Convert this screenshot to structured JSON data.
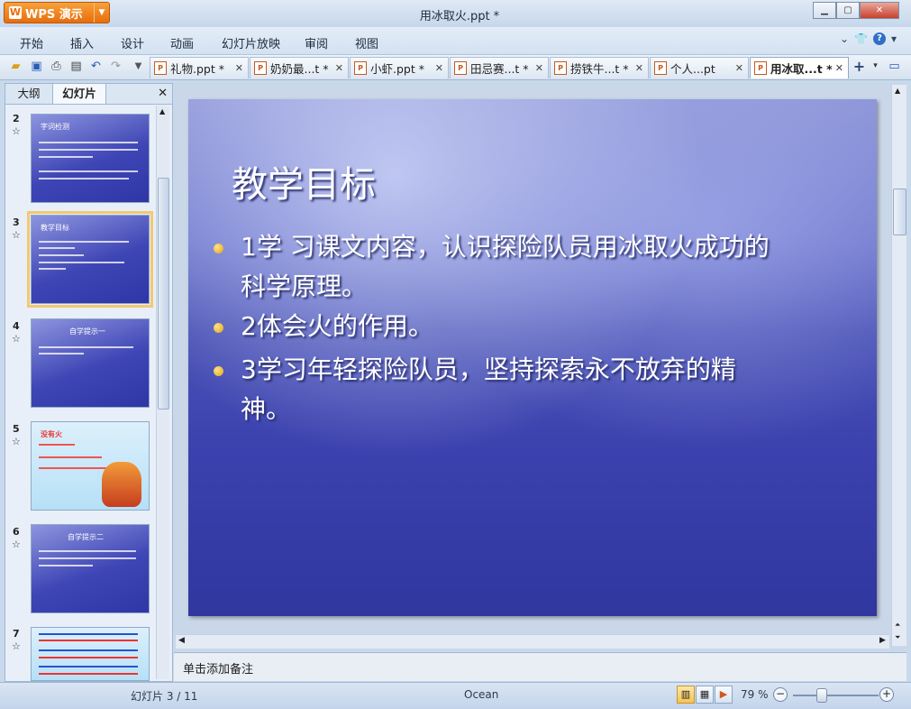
{
  "app": {
    "brand": "WPS 演示",
    "window_title": "用冰取火.ppt *"
  },
  "menu": [
    "开始",
    "插入",
    "设计",
    "动画",
    "幻灯片放映",
    "审阅",
    "视图"
  ],
  "tabs": [
    {
      "label": "礼物.ppt *"
    },
    {
      "label": "奶奶最...t *"
    },
    {
      "label": "小虾.ppt *"
    },
    {
      "label": "田忌赛...t *"
    },
    {
      "label": "捞铁牛...t *"
    },
    {
      "label": "个人...pt"
    },
    {
      "label": "用冰取...t *"
    }
  ],
  "left_pane": {
    "tab_outline": "大纲",
    "tab_slides": "幻灯片",
    "thumbnails": [
      {
        "num": "2",
        "title": "字词检测"
      },
      {
        "num": "3",
        "title": "教学目标"
      },
      {
        "num": "4",
        "title": "自学提示一"
      },
      {
        "num": "5",
        "title": "没有火"
      },
      {
        "num": "6",
        "title": "自学提示二"
      },
      {
        "num": "7",
        "title": ""
      }
    ]
  },
  "slide": {
    "title": "教学目标",
    "bullets": [
      "1学 习课文内容，认识探险队员用冰取火成功的科学原理。",
      "2体会火的作用。",
      "3学习年轻探险队员，坚持探索永不放弃的精神。"
    ]
  },
  "notes_placeholder": "单击添加备注",
  "status": {
    "slide_indicator": "幻灯片 3 / 11",
    "theme": "Ocean",
    "zoom": "79 %"
  },
  "colors": {
    "accent": "#e86d0a",
    "slide_bg": "#3a40ad",
    "bullet": "#f2c23a"
  }
}
